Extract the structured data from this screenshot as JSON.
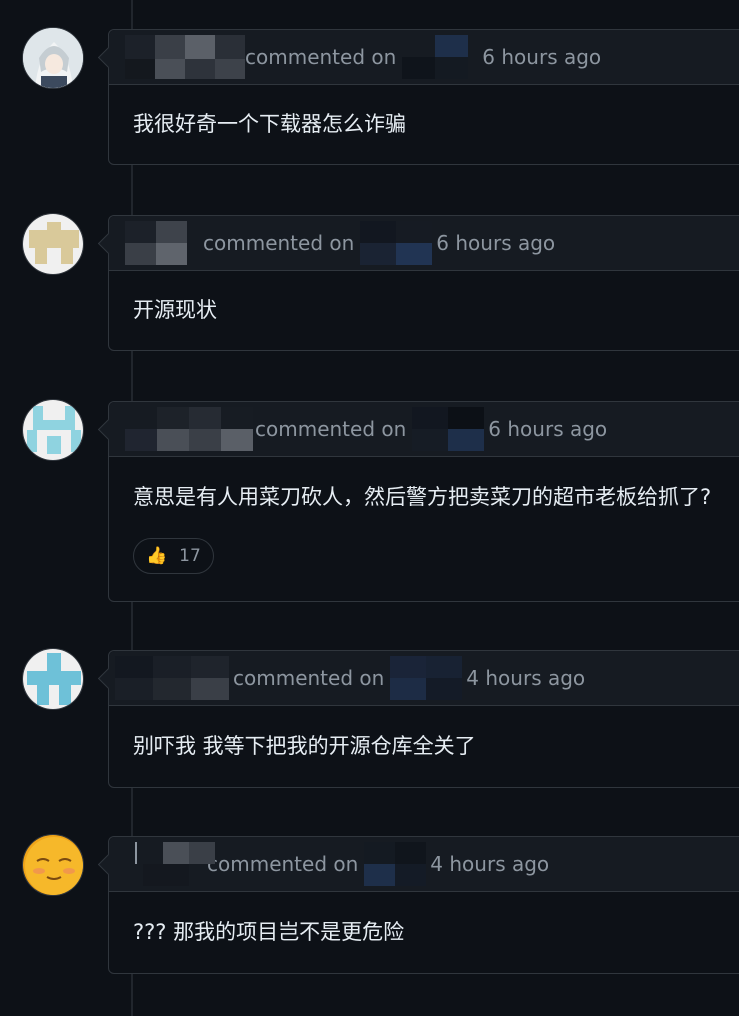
{
  "comments": [
    {
      "action": "commented on",
      "time": "6 hours ago",
      "body": "我很好奇一个下载器怎么诈骗",
      "avatar_icon": "anime-character-avatar"
    },
    {
      "action": "commented on",
      "time": "6 hours ago",
      "body": "开源现状",
      "avatar_icon": "identicon-avatar-tan"
    },
    {
      "action": "commented on",
      "time": "6 hours ago",
      "body": "意思是有人用菜刀砍人，然后警方把卖菜刀的超市老板给抓了?",
      "avatar_icon": "identicon-avatar-cyan",
      "reaction": {
        "emoji": "👍",
        "count": "17"
      }
    },
    {
      "action": "commented on",
      "time": "4 hours ago",
      "body": "别吓我 我等下把我的开源仓库全关了",
      "avatar_icon": "identicon-avatar-blue"
    },
    {
      "action": "commented on",
      "time": "4 hours ago",
      "body": "??? 那我的项目岂不是更危险",
      "avatar_icon": "emoji-face-avatar"
    }
  ],
  "colors": {
    "background": "#0d1117",
    "card_header": "#161b22",
    "border": "#30363d",
    "muted_text": "#8d96a0",
    "body_text": "#e6edf3"
  }
}
